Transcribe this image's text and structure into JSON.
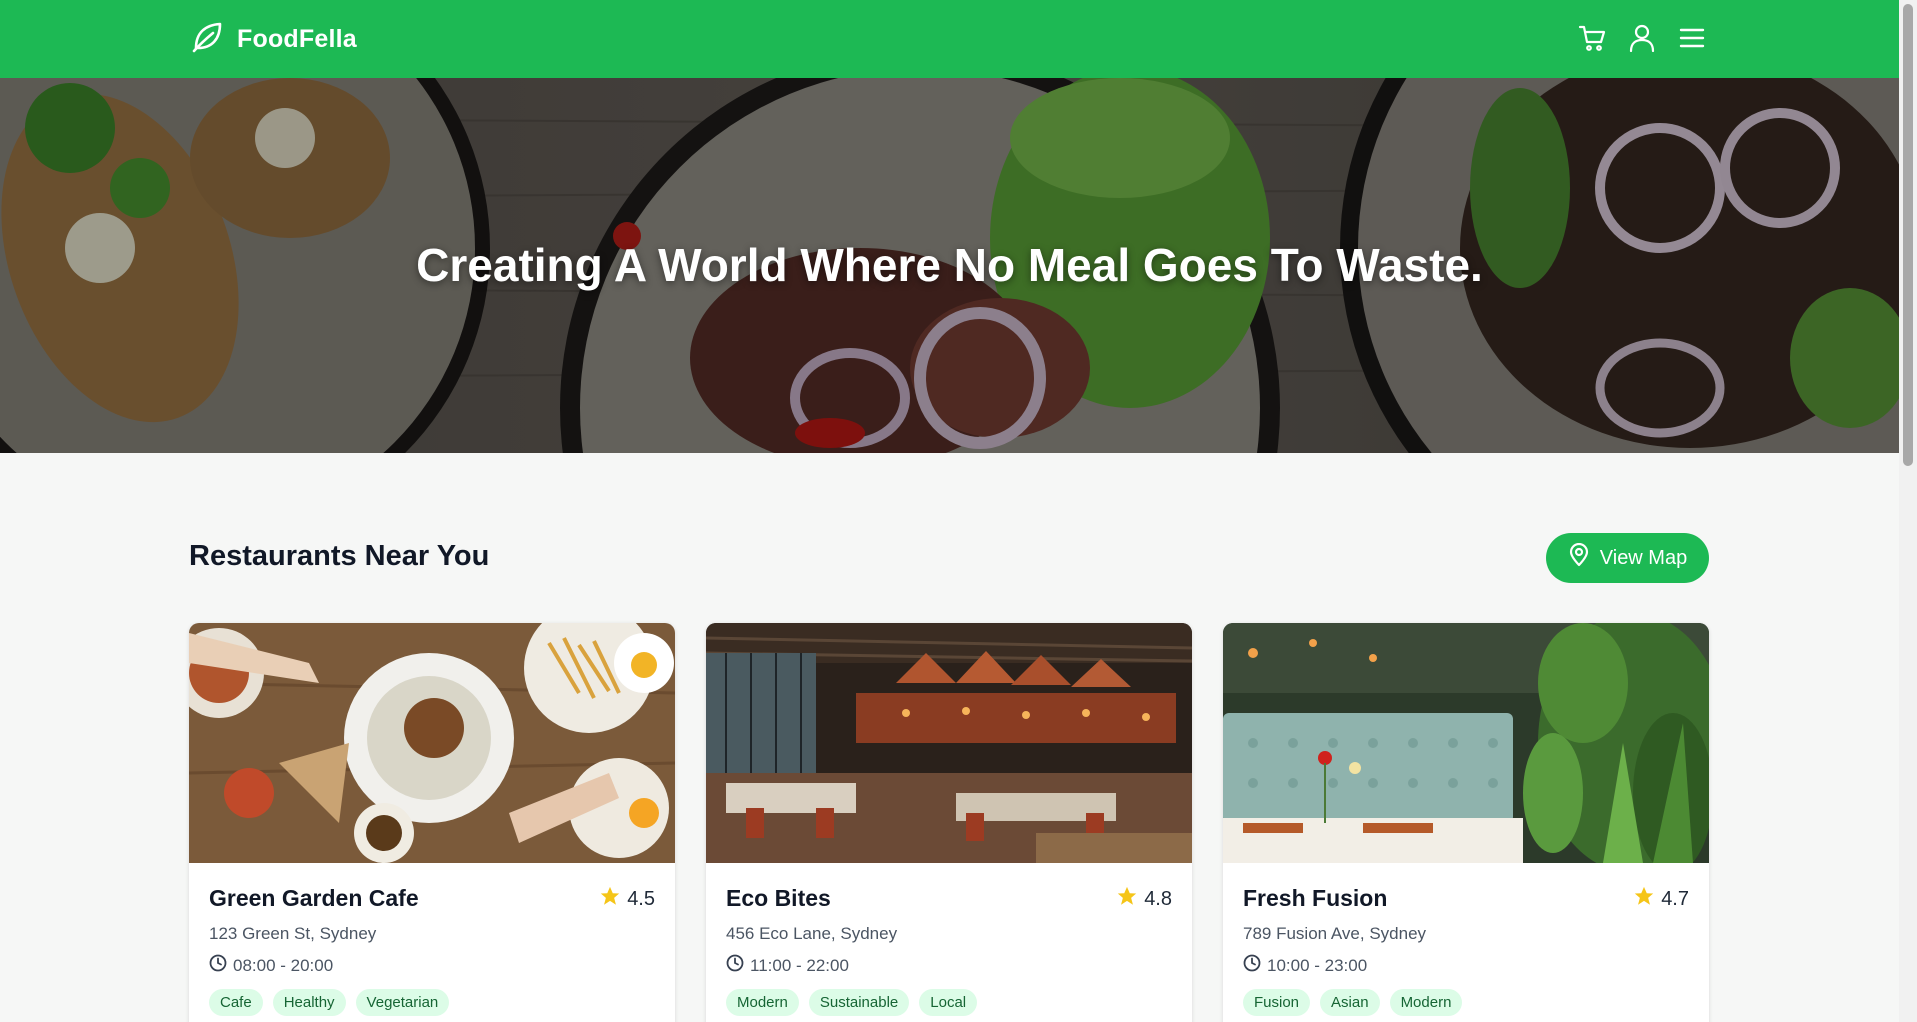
{
  "header": {
    "brand": "FoodFella",
    "icons": [
      "leaf-icon",
      "cart-icon",
      "user-icon",
      "menu-icon"
    ]
  },
  "hero": {
    "title": "Creating A World Where No Meal Goes To Waste."
  },
  "section": {
    "title": "Restaurants Near You",
    "map_button": "View Map"
  },
  "restaurants": [
    {
      "name": "Green Garden Cafe",
      "rating": "4.5",
      "address": "123 Green St, Sydney",
      "hours": "08:00 - 20:00",
      "tags": [
        "Cafe",
        "Healthy",
        "Vegetarian"
      ]
    },
    {
      "name": "Eco Bites",
      "rating": "4.8",
      "address": "456 Eco Lane, Sydney",
      "hours": "11:00 - 22:00",
      "tags": [
        "Modern",
        "Sustainable",
        "Local"
      ]
    },
    {
      "name": "Fresh Fusion",
      "rating": "4.7",
      "address": "789 Fusion Ave, Sydney",
      "hours": "10:00 - 23:00",
      "tags": [
        "Fusion",
        "Asian",
        "Modern"
      ]
    }
  ],
  "colors": {
    "brand_green": "#1db954",
    "tag_bg": "#dcfce7",
    "tag_text": "#166534",
    "star": "#f5c518"
  }
}
